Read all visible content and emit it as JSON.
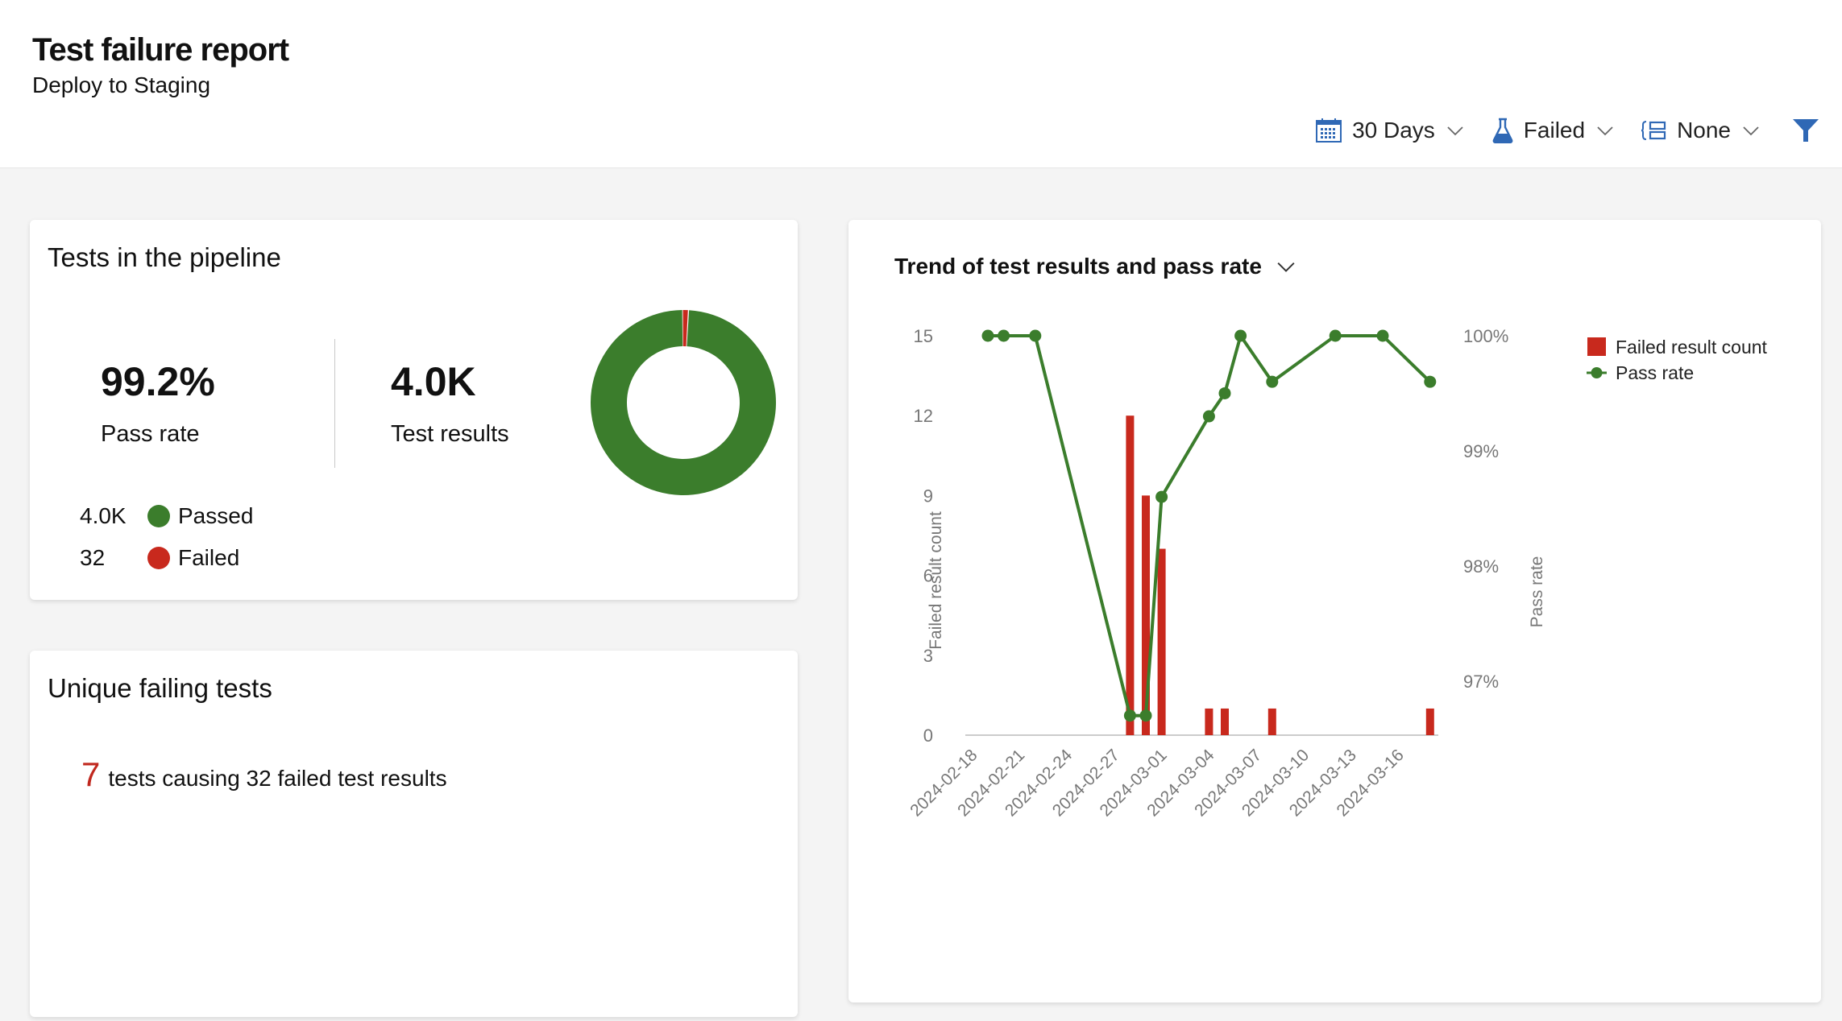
{
  "header": {
    "title": "Test failure report",
    "subtitle": "Deploy to Staging",
    "filters": [
      {
        "icon": "calendar-icon",
        "label": "30 Days"
      },
      {
        "icon": "flask-icon",
        "label": "Failed"
      },
      {
        "icon": "group-by-icon",
        "label": "None"
      }
    ],
    "filter_icon": "filter-icon",
    "accent": "#2f68b5"
  },
  "pipeline_card": {
    "title": "Tests in the pipeline",
    "pass_rate_value": "99.2%",
    "pass_rate_label": "Pass rate",
    "results_value": "4.0K",
    "results_label": "Test results",
    "legend": [
      {
        "count": "4.0K",
        "label": "Passed",
        "color": "#3b7d2c"
      },
      {
        "count": "32",
        "label": "Failed",
        "color": "#c8291d"
      }
    ],
    "donut": {
      "passed_fraction": 0.992,
      "failed_fraction": 0.008
    }
  },
  "unique_card": {
    "title": "Unique failing tests",
    "count": "7",
    "text": "tests causing 32 failed test results"
  },
  "trend_card": {
    "title": "Trend of test results and pass rate"
  },
  "chart_data": {
    "type": "bar+line",
    "title": "Trend of test results and pass rate",
    "xlabel": "",
    "ylabel_left": "Failed result count",
    "ylabel_right": "Pass rate",
    "left_ylim": [
      0,
      15
    ],
    "left_ticks": [
      "0",
      "3",
      "6",
      "9",
      "12",
      "15"
    ],
    "right_ylim": [
      96.53,
      100
    ],
    "right_ticks": [
      {
        "v": 97,
        "label": "97%"
      },
      {
        "v": 98,
        "label": "98%"
      },
      {
        "v": 99,
        "label": "99%"
      },
      {
        "v": 100,
        "label": "100%"
      }
    ],
    "x_tick_labels": [
      "2024-02-18",
      "2024-02-21",
      "2024-02-24",
      "2024-02-27",
      "2024-03-01",
      "2024-03-04",
      "2024-03-07",
      "2024-03-10",
      "2024-03-13",
      "2024-03-16"
    ],
    "x_start": "2024-02-18",
    "x_days": 30,
    "legend": [
      {
        "name": "Failed result count",
        "color": "#c8291d",
        "type": "bar"
      },
      {
        "name": "Pass rate",
        "color": "#3b7d2c",
        "type": "line"
      }
    ],
    "legend_position": "top-right",
    "series": [
      {
        "name": "Failed result count",
        "type": "bar",
        "color": "#c8291d",
        "points": [
          {
            "x": "2024-02-27",
            "y": 12
          },
          {
            "x": "2024-02-28",
            "y": 9
          },
          {
            "x": "2024-02-29",
            "y": 7
          },
          {
            "x": "2024-03-03",
            "y": 1
          },
          {
            "x": "2024-03-04",
            "y": 1
          },
          {
            "x": "2024-03-07",
            "y": 1
          },
          {
            "x": "2024-03-17",
            "y": 1
          }
        ]
      },
      {
        "name": "Pass rate",
        "type": "line",
        "color": "#3b7d2c",
        "points": [
          {
            "x": "2024-02-18",
            "y": 100
          },
          {
            "x": "2024-02-19",
            "y": 100
          },
          {
            "x": "2024-02-21",
            "y": 100
          },
          {
            "x": "2024-02-27",
            "y": 96.7
          },
          {
            "x": "2024-02-28",
            "y": 96.7
          },
          {
            "x": "2024-02-29",
            "y": 98.6
          },
          {
            "x": "2024-03-03",
            "y": 99.3
          },
          {
            "x": "2024-03-04",
            "y": 99.5
          },
          {
            "x": "2024-03-05",
            "y": 100
          },
          {
            "x": "2024-03-07",
            "y": 99.6
          },
          {
            "x": "2024-03-11",
            "y": 100
          },
          {
            "x": "2024-03-14",
            "y": 100
          },
          {
            "x": "2024-03-17",
            "y": 99.6
          }
        ]
      }
    ]
  }
}
